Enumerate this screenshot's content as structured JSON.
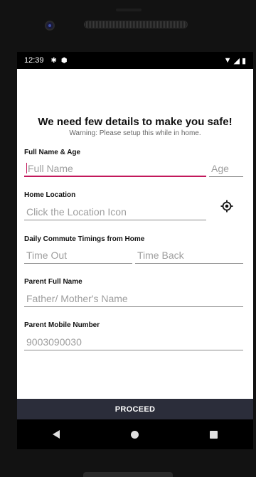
{
  "status": {
    "time": "12:39"
  },
  "header": {
    "title": "We need few details to make you safe!",
    "subtitle": "Warning: Please setup this while in home."
  },
  "form": {
    "name_age": {
      "label": "Full Name & Age",
      "name_placeholder": "Full Name",
      "age_placeholder": "Age"
    },
    "home_location": {
      "label": "Home Location",
      "placeholder": "Click the Location Icon"
    },
    "commute": {
      "label": "Daily Commute Timings from Home",
      "out_placeholder": "Time Out",
      "back_placeholder": "Time Back"
    },
    "parent_name": {
      "label": "Parent Full Name",
      "placeholder": "Father/ Mother's Name"
    },
    "parent_mobile": {
      "label": "Parent Mobile Number",
      "placeholder": "9003090030"
    }
  },
  "actions": {
    "proceed_label": "PROCEED"
  },
  "colors": {
    "accent": "#c2185b",
    "button_bg": "#2b2d3a"
  }
}
